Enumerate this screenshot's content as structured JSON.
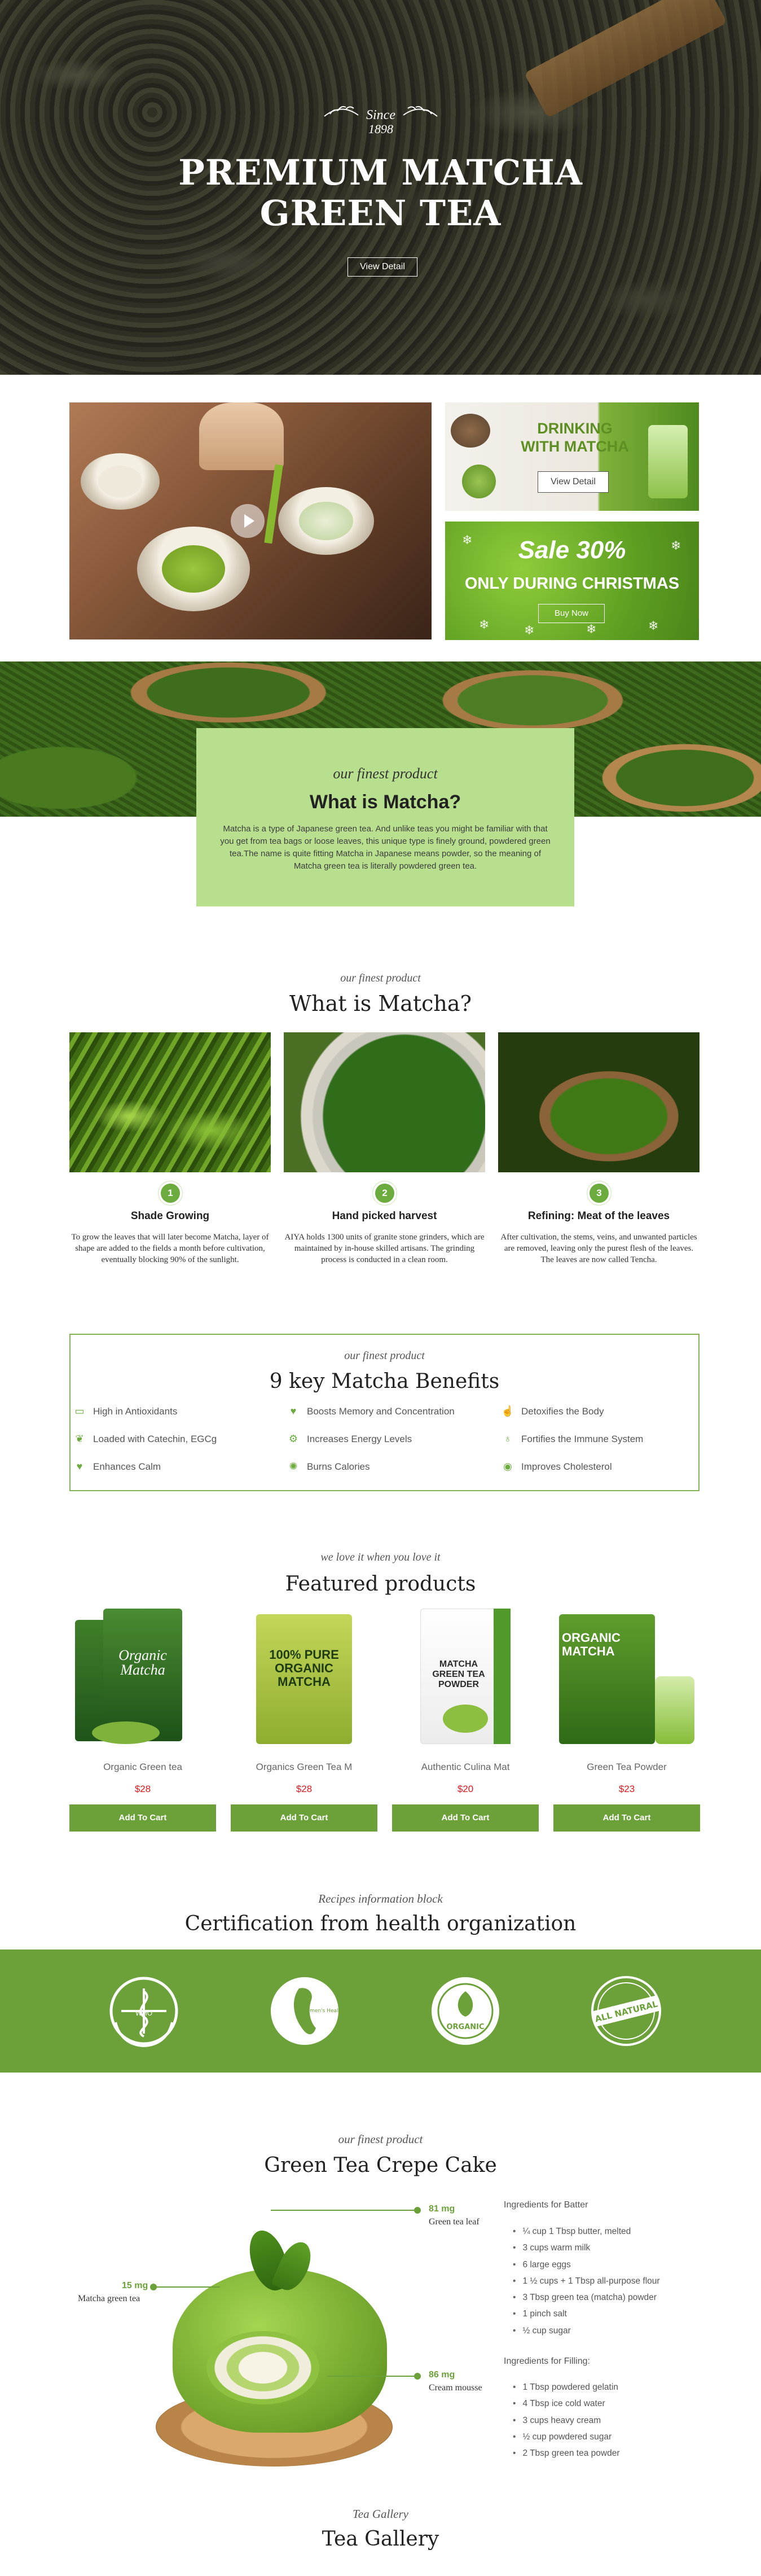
{
  "hero": {
    "since_label": "Since",
    "since_year": "1898",
    "title_line1": "PREMIUM MATCHA",
    "title_line2": "GREEN TEA",
    "button": "View Detail"
  },
  "promos": {
    "drinking_title_line1": "DRINKING",
    "drinking_title_line2": "WITH MATCHA",
    "drinking_button": "View Detail",
    "sale_title": "Sale 30%",
    "sale_subtitle": "ONLY DURING CHRISTMAS",
    "sale_button": "Buy Now"
  },
  "what_box": {
    "tagline": "our finest product",
    "title": "What is Matcha?",
    "text": "Matcha is a type of Japanese green tea. And unlike teas you might be familiar with that you get from tea bags or loose leaves, this unique type is finely ground, powdered green tea.The name is quite fitting Matcha in Japanese means powder, so the meaning of Matcha green tea is literally powdered green tea."
  },
  "process": {
    "tagline": "our finest product",
    "title": "What is Matcha?",
    "steps": [
      {
        "num": "1",
        "title": "Shade Growing",
        "text": "To grow the leaves that will later become Matcha, layer of shape are added to the fields a month before cultivation, eventually blocking 90% of the sunlight."
      },
      {
        "num": "2",
        "title": "Hand picked harvest",
        "text": "AIYA holds 1300 units of granite stone grinders, which are maintained by in-house skilled artisans. The grinding process is conducted in a clean room."
      },
      {
        "num": "3",
        "title": "Refining: Meat of the leaves",
        "text": "After cultivation, the stems, veins, and unwanted particles are removed, leaving only the purest flesh of the leaves. The leaves are now called Tencha."
      }
    ]
  },
  "benefits": {
    "tagline": "our finest product",
    "title": "9 key Matcha Benefits",
    "items": [
      {
        "icon": "battery-icon",
        "label": "High in Antioxidants"
      },
      {
        "icon": "heartbeat-icon",
        "label": "Boosts Memory and Concentration"
      },
      {
        "icon": "thumbs-up-icon",
        "label": "Detoxifies the Body"
      },
      {
        "icon": "leaf-icon",
        "label": "Loaded with Catechin, EGCg"
      },
      {
        "icon": "gear-icon",
        "label": "Increases Energy Levels"
      },
      {
        "icon": "stethoscope-icon",
        "label": "Fortifies the Immune System"
      },
      {
        "icon": "heart-icon",
        "label": "Enhances Calm"
      },
      {
        "icon": "flame-icon",
        "label": "Burns Calories"
      },
      {
        "icon": "eye-icon",
        "label": "Improves Cholesterol"
      }
    ]
  },
  "products": {
    "tagline": "we love it when you love it",
    "title": "Featured products",
    "button": "Add To Cart",
    "items": [
      {
        "name": "Organic Green tea",
        "price": "$28",
        "label": "Organic Matcha"
      },
      {
        "name": "Organics Green Tea M",
        "price": "$28",
        "label": "100% PURE ORGANIC MATCHA"
      },
      {
        "name": "Authentic Culina Mat",
        "price": "$20",
        "label": "MATCHA GREEN TEA POWDER"
      },
      {
        "name": "Green Tea Powder",
        "price": "$23",
        "label": "ORGANIC MATCHA"
      }
    ]
  },
  "certification": {
    "tagline": "Recipes information block",
    "title": "Certification from health organization",
    "badges": [
      "WHO",
      "Women's Health",
      "ORGANIC",
      "ALL NATURAL"
    ]
  },
  "recipe": {
    "tagline": "our finest product",
    "title": "Green Tea Crepe Cake",
    "callouts": [
      {
        "value": "81 mg",
        "label": "Green tea leaf"
      },
      {
        "value": "15 mg",
        "label": "Matcha green tea"
      },
      {
        "value": "86 mg",
        "label": "Cream mousse"
      }
    ],
    "batter_heading": "Ingredients for Batter",
    "batter": [
      "¼ cup 1 Tbsp butter, melted",
      "3 cups warm milk",
      "6 large eggs",
      "1 ½ cups + 1 Tbsp all-purpose flour",
      "3 Tbsp green tea (matcha) powder",
      "1 pinch salt",
      "½ cup sugar"
    ],
    "filling_heading": "Ingredients for Filling:",
    "filling": [
      "1 Tbsp powdered gelatin",
      "4 Tbsp ice cold water",
      "3 cups heavy cream",
      "½ cup powdered sugar",
      "2 Tbsp green tea powder"
    ]
  },
  "gallery": {
    "tagline": "Tea Gallery",
    "title": "Tea Gallery"
  },
  "colors": {
    "accent": "#6ca13a",
    "price": "#e0191d",
    "box": "#b8df8e"
  }
}
